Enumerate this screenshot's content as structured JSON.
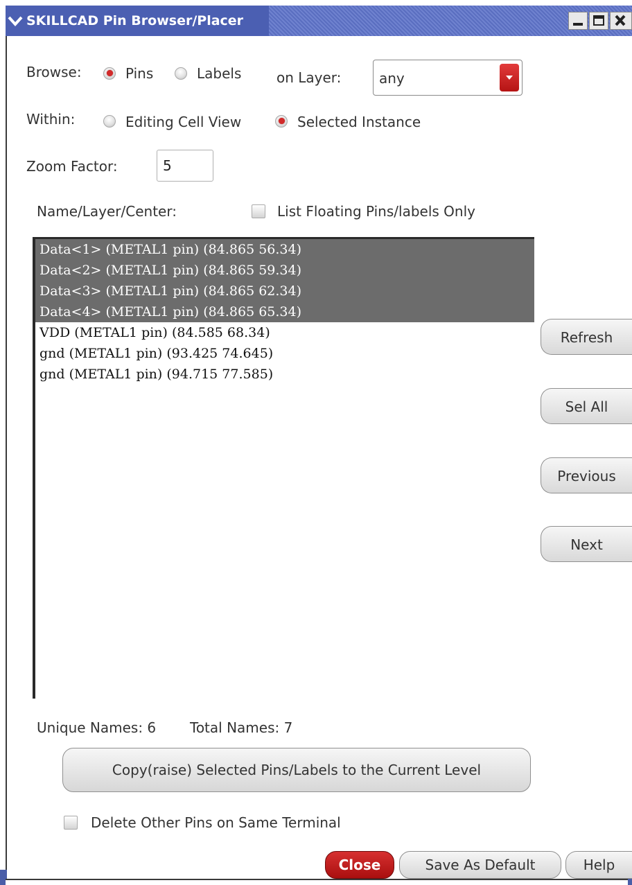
{
  "window": {
    "title": "SKILLCAD Pin Browser/Placer"
  },
  "browse": {
    "label": "Browse:",
    "options": [
      "Pins",
      "Labels"
    ],
    "selected": "Pins"
  },
  "layer": {
    "label": "on Layer:",
    "value": "any"
  },
  "within": {
    "label": "Within:",
    "options": [
      "Editing Cell View",
      "Selected Instance"
    ],
    "selected": "Selected Instance"
  },
  "zoom": {
    "label": "Zoom Factor:",
    "value": "5"
  },
  "list": {
    "header_label": "Name/Layer/Center:",
    "floating_only_label": "List Floating Pins/labels Only",
    "floating_only_checked": false,
    "items": [
      {
        "text": "Data<1> (METAL1 pin) (84.865 56.34)",
        "selected": true
      },
      {
        "text": "Data<2> (METAL1 pin) (84.865 59.34)",
        "selected": true
      },
      {
        "text": "Data<3> (METAL1 pin) (84.865 62.34)",
        "selected": true
      },
      {
        "text": "Data<4> (METAL1 pin) (84.865 65.34)",
        "selected": true
      },
      {
        "text": "VDD (METAL1 pin) (84.585 68.34)",
        "selected": false
      },
      {
        "text": "gnd (METAL1 pin) (93.425 74.645)",
        "selected": false
      },
      {
        "text": "gnd (METAL1 pin) (94.715 77.585)",
        "selected": false
      }
    ]
  },
  "side_buttons": {
    "refresh": "Refresh",
    "sel_all": "Sel All",
    "previous": "Previous",
    "next": "Next"
  },
  "stats": {
    "unique": "Unique Names: 6",
    "total": "Total Names: 7"
  },
  "copy_button": "Copy(raise) Selected Pins/Labels to the Current Level",
  "delete_other": {
    "label": "Delete Other Pins on Same Terminal",
    "checked": false
  },
  "footer": {
    "close": "Close",
    "save_default": "Save As Default",
    "help": "Help"
  },
  "colors": {
    "titlebar": "#4b5fb2",
    "accent_red": "#c41c1c",
    "selection": "#6c6c6c"
  }
}
